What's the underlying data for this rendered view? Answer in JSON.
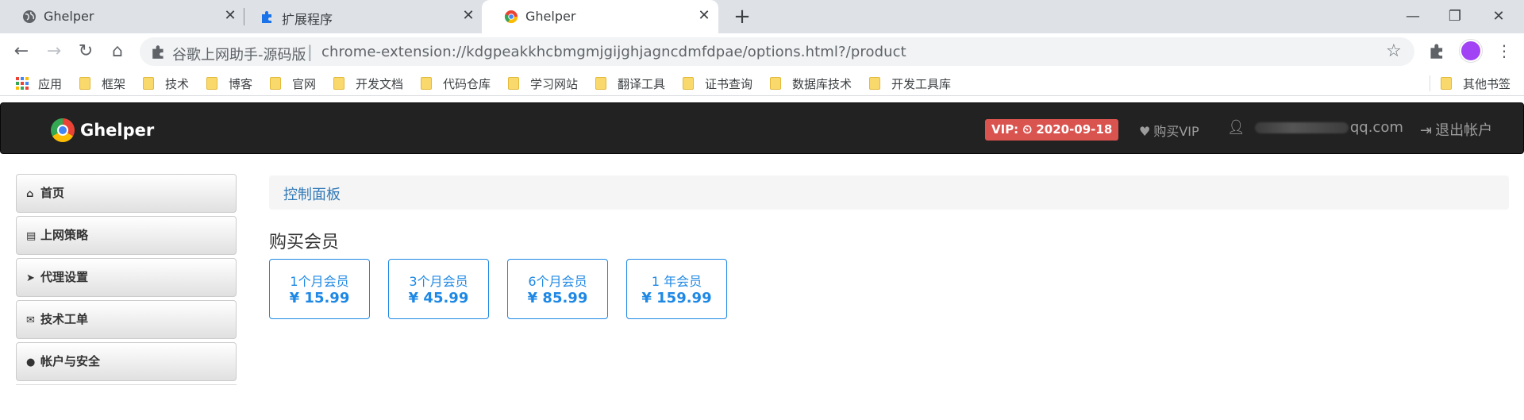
{
  "browser": {
    "tabs": [
      {
        "title": "Ghelper",
        "icon": "globe-icon",
        "active": false
      },
      {
        "title": "扩展程序",
        "icon": "puzzle-icon",
        "active": false
      },
      {
        "title": "Ghelper",
        "icon": "chrome-icon",
        "active": true
      }
    ],
    "omnibox": {
      "site_label": "谷歌上网助手-源码版",
      "separator": "|",
      "url": "chrome-extension://kdgpeakkhcbmgmjgijghjagncdmfdpae/options.html?/product"
    },
    "bookmarks": [
      {
        "label": "应用",
        "icon": "apps-icon"
      },
      {
        "label": "框架",
        "icon": "folder-icon"
      },
      {
        "label": "技术",
        "icon": "folder-icon"
      },
      {
        "label": "博客",
        "icon": "folder-icon"
      },
      {
        "label": "官网",
        "icon": "folder-icon"
      },
      {
        "label": "开发文档",
        "icon": "folder-icon"
      },
      {
        "label": "代码仓库",
        "icon": "folder-icon"
      },
      {
        "label": "学习网站",
        "icon": "folder-icon"
      },
      {
        "label": "翻译工具",
        "icon": "folder-icon"
      },
      {
        "label": "证书查询",
        "icon": "folder-icon"
      },
      {
        "label": "数据库技术",
        "icon": "folder-icon"
      },
      {
        "label": "开发工具库",
        "icon": "folder-icon"
      },
      {
        "label": "其他书签",
        "icon": "folder-icon"
      }
    ]
  },
  "app": {
    "brand": "Ghelper",
    "vip_badge": "VIP: ⏲ 2020-09-18",
    "buy_vip": "购买VIP",
    "user_email_suffix": "qq.com",
    "logout": "退出帐户",
    "colors": {
      "navbar": "#222222",
      "accent": "#1e88e5",
      "badge": "#d9534f"
    }
  },
  "sidebar": {
    "items": [
      {
        "label": "首页",
        "icon": "home-icon"
      },
      {
        "label": "上网策略",
        "icon": "list-icon"
      },
      {
        "label": "代理设置",
        "icon": "send-icon"
      },
      {
        "label": "技术工单",
        "icon": "envelope-icon"
      },
      {
        "label": "帐户与安全",
        "icon": "user-icon"
      }
    ]
  },
  "main": {
    "breadcrumb": "控制面板",
    "section_title": "购买会员",
    "plans": [
      {
        "name": "1个月会员",
        "price": "¥ 15.99"
      },
      {
        "name": "3个月会员",
        "price": "¥ 45.99"
      },
      {
        "name": "6个月会员",
        "price": "¥ 85.99"
      },
      {
        "name": "1 年会员",
        "price": "¥ 159.99"
      }
    ]
  }
}
